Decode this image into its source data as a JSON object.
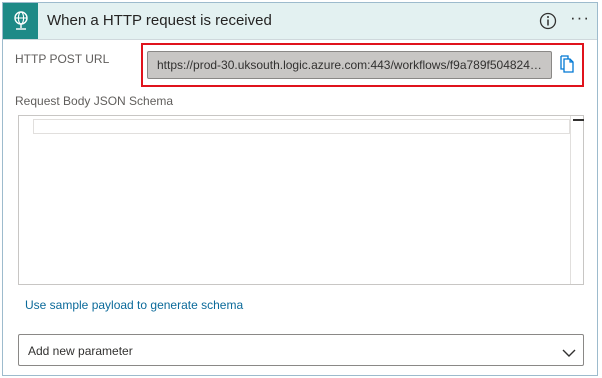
{
  "header": {
    "title": "When a HTTP request is received",
    "trigger_icon": "http-globe-icon",
    "info_icon": "info-icon",
    "more_label": "···"
  },
  "fields": {
    "post_url_label": "HTTP POST URL",
    "post_url_value": "https://prod-30.uksouth.logic.azure.com:443/workflows/f9a789f504824d...",
    "copy_icon": "copy-icon",
    "schema_label": "Request Body JSON Schema",
    "schema_value": ""
  },
  "actions": {
    "sample_payload_link": "Use sample payload to generate schema",
    "add_parameter_placeholder": "Add new parameter",
    "dropdown_icon": "chevron-down-icon"
  },
  "colors": {
    "accent": "#1e8a87",
    "header_bg": "#e3f1f1",
    "highlight": "#e0131c",
    "link": "#0b6a9a"
  }
}
